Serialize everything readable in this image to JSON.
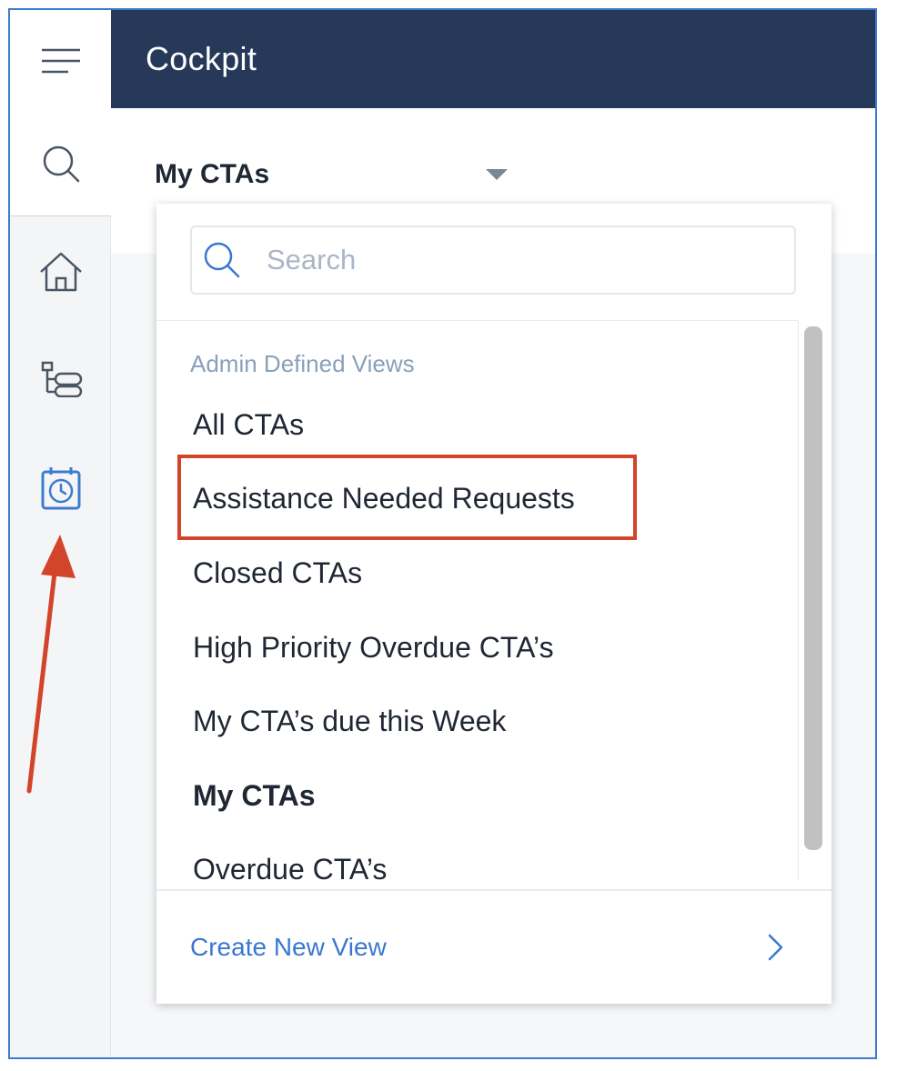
{
  "header": {
    "title": "Cockpit"
  },
  "rail": {
    "icons": [
      "menu-icon",
      "search-icon",
      "home-icon",
      "hierarchy-icon",
      "calendar-clock-icon"
    ],
    "active_color": "#3d7bd0"
  },
  "view_selector": {
    "label": "My CTAs"
  },
  "dropdown": {
    "search_placeholder": "Search",
    "group_label": "Admin Defined Views",
    "items": [
      "All CTAs",
      "Assistance Needed Requests",
      "Closed CTAs",
      "High Priority Overdue CTA’s",
      "My CTA’s due this Week",
      "My CTAs",
      "Overdue CTA’s"
    ],
    "selected_item": "My CTAs",
    "highlighted_item": "Assistance Needed Requests",
    "footer_link": "Create New View"
  },
  "colors": {
    "header_bg": "#263959",
    "highlight_border": "#d2452b",
    "link": "#3a78d0",
    "annotation_arrow": "#d2452b"
  }
}
